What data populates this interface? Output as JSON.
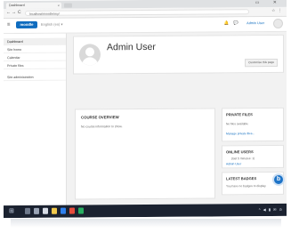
{
  "browser": {
    "tab_title": "Dashboard",
    "tab_close": "×",
    "window_controls": "▭ ✕",
    "url": "localhost/moodle/my/",
    "back": "←",
    "forward": "→",
    "reload": "C",
    "address_icons": "☆ ⋮"
  },
  "navbar": {
    "menu_icon": "≡",
    "logo_text": "moodle",
    "language": "English (en) ▾",
    "icons": "🔔 💬",
    "user_name": "Admin User"
  },
  "drawer": {
    "items": [
      {
        "label": "Dashboard"
      },
      {
        "label": "Site home"
      },
      {
        "label": "Calendar"
      },
      {
        "label": "Private files"
      },
      {
        "label": "Site administration"
      }
    ]
  },
  "header": {
    "title": "Admin User",
    "customise_button": "Customise this page"
  },
  "course_overview": {
    "title": "COURSE OVERVIEW",
    "message": "No course information to show."
  },
  "private_files": {
    "title": "PRIVATE FILES",
    "empty": "No files available",
    "link": "Manage private files..."
  },
  "online_users": {
    "title": "ONLINE USERS",
    "text": "(last 5 minutes: 1)",
    "user": "Admin User"
  },
  "latest_badges": {
    "title": "LATEST BADGES",
    "text": "You have no badges to display"
  },
  "fab_label": "b",
  "taskbar": {
    "start": "⊞",
    "tray": "^ ◀ ▮ ✉ ⊙"
  },
  "colors": {
    "accent": "#0f6cbf",
    "taskbar": "#1b2230"
  }
}
